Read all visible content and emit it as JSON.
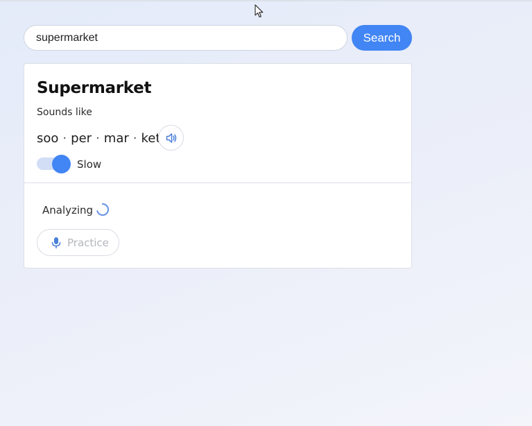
{
  "search": {
    "value": "supermarket",
    "button_label": "Search"
  },
  "result": {
    "word": "Supermarket",
    "sounds_like_label": "Sounds like",
    "syllables": [
      "soo",
      "per",
      "mar",
      "ket"
    ],
    "separator": "·",
    "speaker_icon": "speaker-icon",
    "slow_toggle": {
      "label": "Slow",
      "enabled": true
    }
  },
  "analysis": {
    "status_label": "Analyzing",
    "spinner_icon": "loading-spinner-icon",
    "practice_label": "Practice",
    "practice_icon": "microphone-icon"
  },
  "colors": {
    "accent": "#4285f4",
    "toggle_track": "#d2def6",
    "disabled_text": "#b3b6bb"
  }
}
